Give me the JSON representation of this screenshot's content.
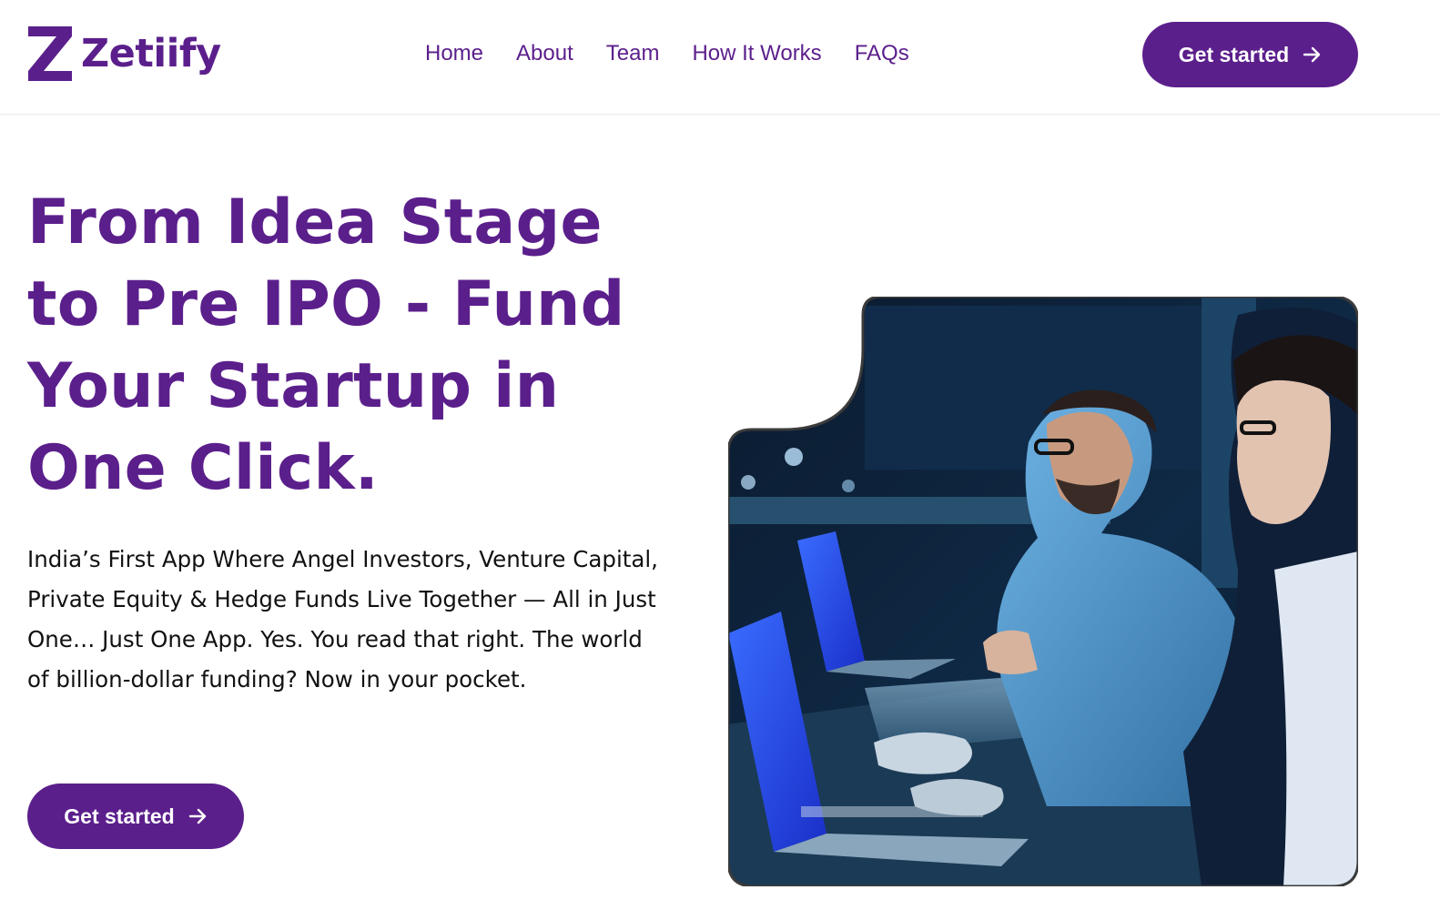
{
  "brand": {
    "name": "Zetiify",
    "logo_letter": "Z",
    "color": "#5b1f8c"
  },
  "nav": {
    "items": [
      "Home",
      "About",
      "Team",
      "How It Works",
      "FAQs"
    ]
  },
  "header": {
    "cta_label": "Get started"
  },
  "hero": {
    "title": "From Idea Stage to Pre IPO - Fund Your Startup in One Click.",
    "description": "India’s First App Where Angel Investors, Venture Capital, Private Equity & Hedge Funds Live Together — All in Just One… Just One App. Yes. You read that right. The world of billion-dollar funding? Now in your pocket.",
    "cta_label": "Get started"
  },
  "icons": {
    "cta_arrow": "arrow-right-icon"
  }
}
